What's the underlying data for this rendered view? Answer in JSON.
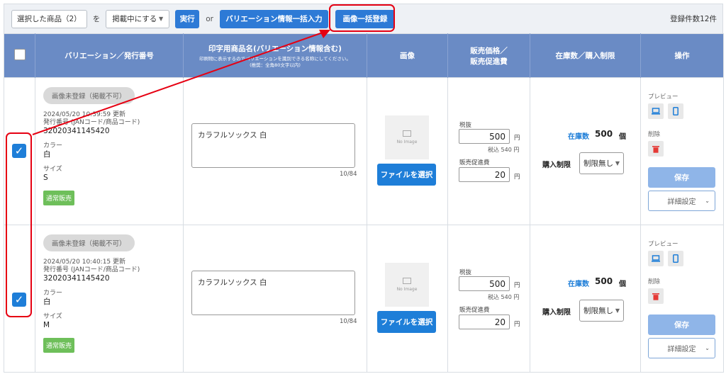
{
  "toolbar": {
    "selected_label": "選択した商品（2）",
    "wo": "を",
    "status_select": "掲載中にする",
    "run_button": "実行",
    "or": "or",
    "bulk_variation_button": "バリエーション情報一括入力",
    "bulk_image_button": "画像一括登録",
    "count": "登録件数12件"
  },
  "header": {
    "variation": "バリエーション／発行番号",
    "print_name": "印字用商品名(バリエーション情報含む)",
    "print_name_sub1": "印刷物に表示するのでバリエーションを識別できる名称にしてください。",
    "print_name_sub2": "(推奨：全角80文字以内)",
    "image": "画像",
    "price1": "販売価格／",
    "price2": "販売促進費",
    "stock": "在庫数／購入制限",
    "ops": "操作"
  },
  "rows": [
    {
      "status": "画像未登録（掲載不可）",
      "updated": "2024/05/20 10:39:59 更新",
      "issue_label": "発行番号 (JANコード/商品コード)",
      "issue_no": "32020341145420",
      "color_label": "カラー",
      "color": "白",
      "size_label": "サイズ",
      "size": "S",
      "sale_tag": "通常販売",
      "name": "カラフルソックス 白",
      "counter": "10/84",
      "noimage": "No Image",
      "file_button": "ファイルを選択",
      "tax_excl_label": "税抜",
      "price": "500",
      "yen": "円",
      "tax_incl": "税込 540 円",
      "promo_label": "販売促進費",
      "promo": "20",
      "stock_label": "在庫数",
      "stock": "500",
      "stock_unit": "個",
      "limit_label": "購入制限",
      "limit_value": "制限無し",
      "preview_label": "プレビュー",
      "delete_label": "削除",
      "save": "保存",
      "detail": "詳細設定"
    },
    {
      "status": "画像未登録（掲載不可）",
      "updated": "2024/05/20 10:40:15 更新",
      "issue_label": "発行番号 (JANコード/商品コード)",
      "issue_no": "32020341145420",
      "color_label": "カラー",
      "color": "白",
      "size_label": "サイズ",
      "size": "M",
      "sale_tag": "通常販売",
      "name": "カラフルソックス 白",
      "counter": "10/84",
      "noimage": "No Image",
      "file_button": "ファイルを選択",
      "tax_excl_label": "税抜",
      "price": "500",
      "yen": "円",
      "tax_incl": "税込 540 円",
      "promo_label": "販売促進費",
      "promo": "20",
      "stock_label": "在庫数",
      "stock": "500",
      "stock_unit": "個",
      "limit_label": "購入制限",
      "limit_value": "制限無し",
      "preview_label": "プレビュー",
      "delete_label": "削除",
      "save": "保存",
      "detail": "詳細設定"
    }
  ],
  "colors": {
    "accent": "#2d7ad6",
    "header": "#6a8bc5",
    "annotation": "#e60012",
    "green_tag": "#6ebf5a"
  }
}
